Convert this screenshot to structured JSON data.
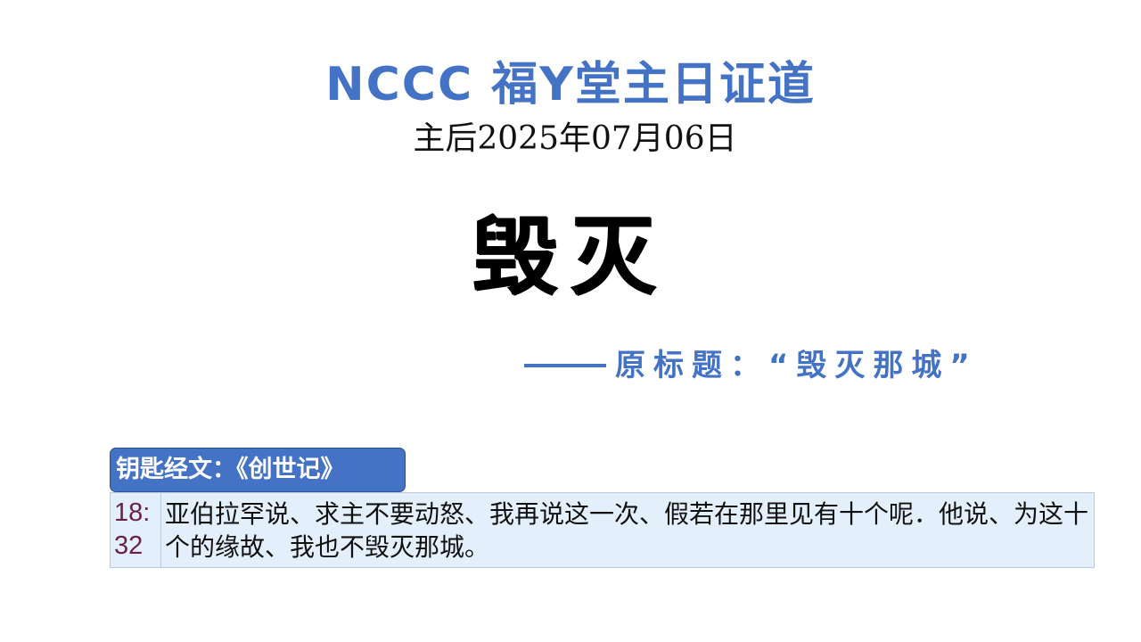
{
  "header": {
    "title": "NCCC 福Y堂主日证道",
    "date": "主后2025年07月06日"
  },
  "sermon": {
    "title": "毁灭",
    "subtitle": "原标题：“毁灭那城”"
  },
  "scripture": {
    "label": "钥匙经文：《创世记》",
    "reference": "18:32",
    "text": "亚伯拉罕说、求主不要动怒、我再说这一次、假若在那里见有十个呢．他说、为这十个的缘故、我也不毁灭那城。"
  },
  "colors": {
    "accent": "#4472c4",
    "verse_background": "#e3effb",
    "reference_color": "#6b1f4f"
  }
}
